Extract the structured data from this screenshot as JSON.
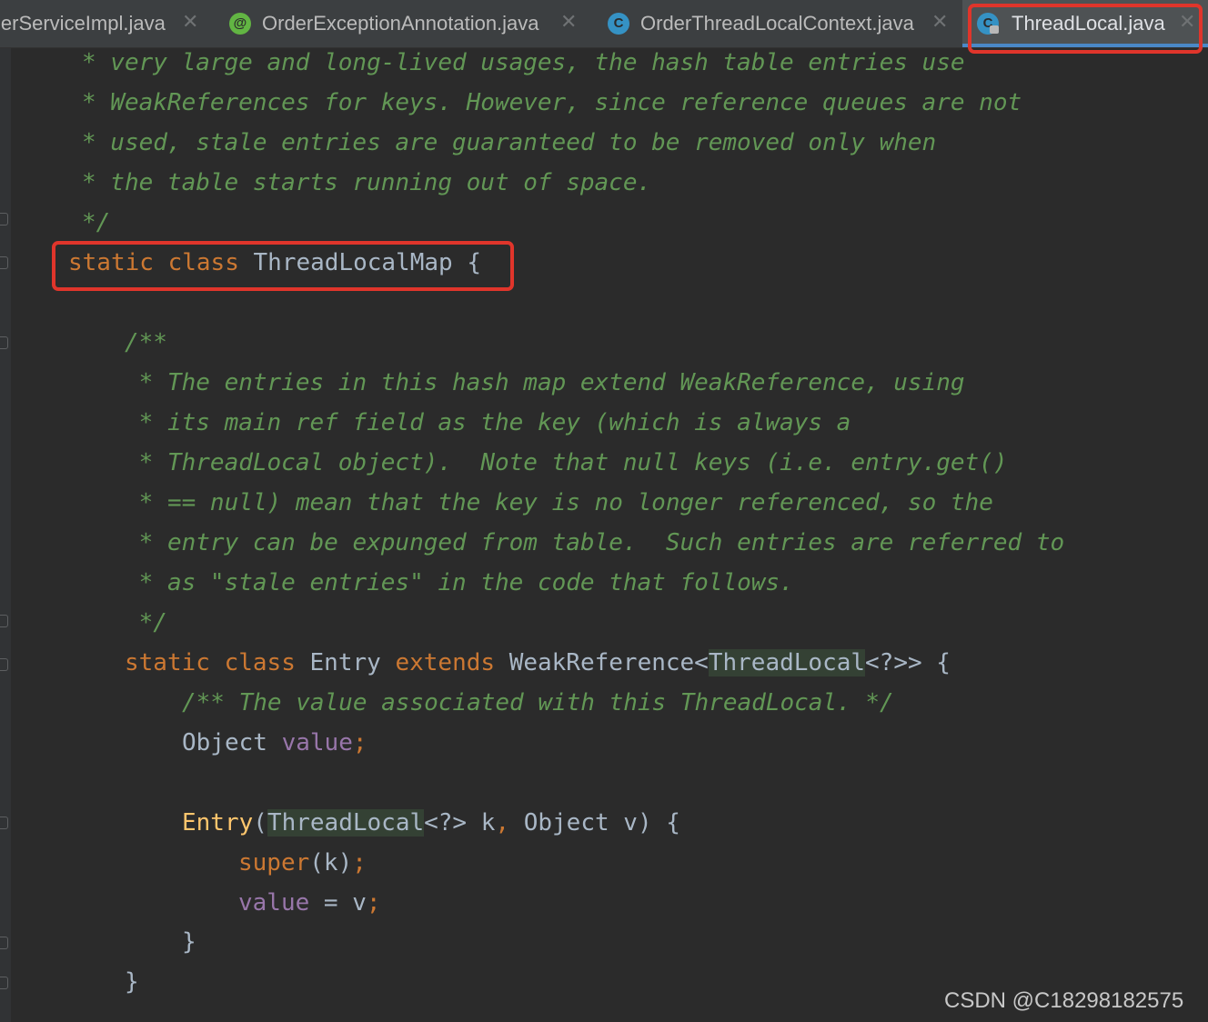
{
  "tabs": [
    {
      "label": "lerServiceImpl.java",
      "icon": "none",
      "active": false
    },
    {
      "label": "OrderExceptionAnnotation.java",
      "icon": "annotation-icon",
      "icon_glyph": "@",
      "active": false
    },
    {
      "label": "OrderThreadLocalContext.java",
      "icon": "class-icon",
      "icon_glyph": "C",
      "active": false
    },
    {
      "label": "ThreadLocal.java",
      "icon": "class-locked-icon",
      "icon_glyph": "C",
      "active": true
    }
  ],
  "tab_close_glyph": "✕",
  "code": {
    "comment_outer": [
      "* very large and long-lived usages, the hash table entries use",
      "* WeakReferences for keys. However, since reference queues are not",
      "* used, stale entries are guaranteed to be removed only when",
      "* the table starts running out of space.",
      "*/"
    ],
    "class_decl": {
      "kw1": "static",
      "kw2": "class",
      "name": "ThreadLocalMap",
      "brace": "{"
    },
    "comment_inner": [
      "/**",
      " * The entries in this hash map extend WeakReference, using",
      " * its main ref field as the key (which is always a",
      " * ThreadLocal object).  Note that null keys (i.e. entry.get()",
      " * == null) mean that the key is no longer referenced, so the",
      " * entry can be expunged from table.  Such entries are referred to",
      " * as \"stale entries\" in the code that follows.",
      " */"
    ],
    "entry_decl": {
      "kw1": "static",
      "kw2": "class",
      "name": "Entry",
      "kw3": "extends",
      "super_type": "WeakReference<",
      "generic": "ThreadLocal",
      "rest": "<?>> {"
    },
    "value_comment": "/** The value associated with this ThreadLocal. */",
    "field_decl": {
      "type": "Object",
      "name": "value",
      "semi": ";"
    },
    "ctor": {
      "name": "Entry",
      "paren": "(",
      "generic": "ThreadLocal",
      "params_a": "<?> k",
      "comma": ",",
      "params_b": " Object v) {"
    },
    "super_call": {
      "kw": "super",
      "args": "(k)",
      "semi": ";"
    },
    "assign": {
      "field": "value",
      "op": " = v",
      "semi": ";"
    },
    "close_inner": "}",
    "close_outer": "}"
  },
  "watermark": "CSDN @C18298182575",
  "colors": {
    "background": "#2b2b2b",
    "comment": "#629755",
    "keyword": "#cc7832",
    "field": "#9876aa",
    "method": "#ffc66d",
    "text": "#a9b7c6",
    "highlight": "#e0352b"
  }
}
